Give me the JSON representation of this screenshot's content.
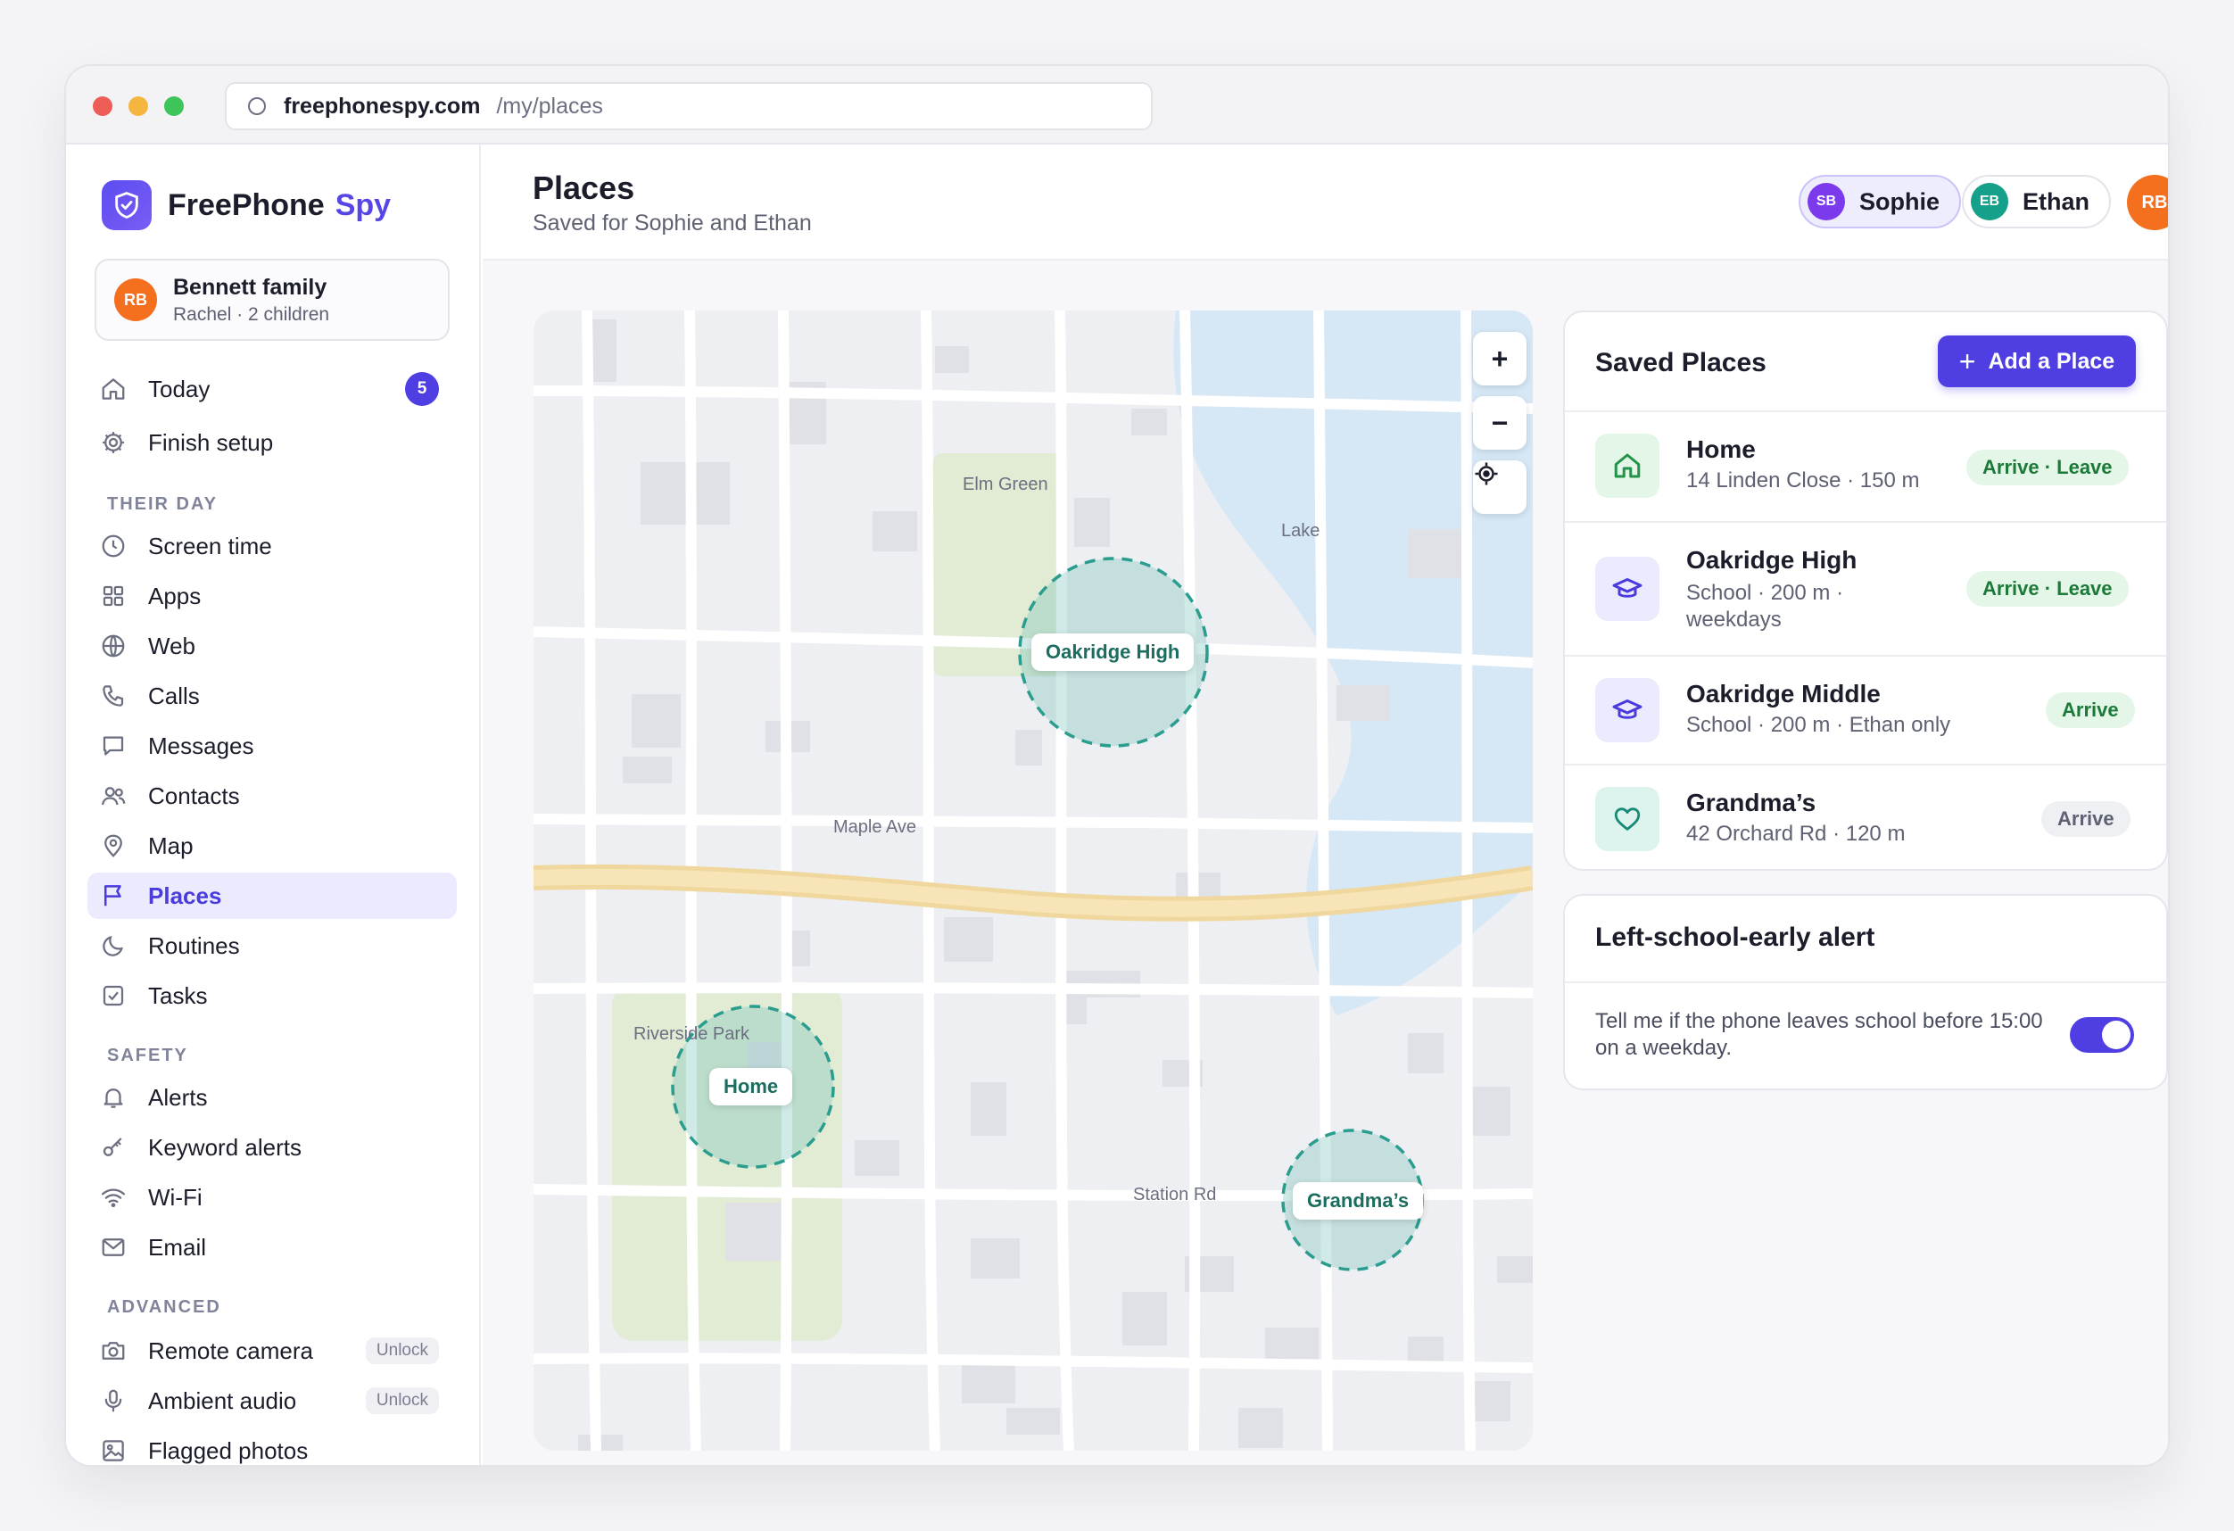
{
  "browser": {
    "domain": "freephonespy.com",
    "path": "/my/places"
  },
  "brand": {
    "name": "FreePhone",
    "accent": "Spy"
  },
  "family": {
    "initials": "RB",
    "name": "Bennett family",
    "sub": "Rachel · 2 children"
  },
  "nav": {
    "today": {
      "label": "Today",
      "badge": "5"
    },
    "finish_setup": "Finish setup",
    "section_day": "THEIR DAY",
    "screen_time": "Screen time",
    "apps": "Apps",
    "web": "Web",
    "calls": "Calls",
    "messages": "Messages",
    "contacts": "Contacts",
    "map": "Map",
    "places": "Places",
    "routines": "Routines",
    "tasks": "Tasks",
    "section_safety": "SAFETY",
    "alerts": "Alerts",
    "keyword_alerts": "Keyword alerts",
    "wifi": "Wi-Fi",
    "email": "Email",
    "section_advanced": "ADVANCED",
    "remote_camera": {
      "label": "Remote camera",
      "badge": "Unlock"
    },
    "ambient_audio": {
      "label": "Ambient audio",
      "badge": "Unlock"
    },
    "flagged_photos": "Flagged photos"
  },
  "header": {
    "title": "Places",
    "subtitle": "Saved for Sophie and Ethan",
    "children": [
      {
        "initials": "SB",
        "name": "Sophie",
        "color": "#7c3aed",
        "active": true
      },
      {
        "initials": "EB",
        "name": "Ethan",
        "color": "#14a08a",
        "active": false
      }
    ],
    "user_initials": "RB"
  },
  "map": {
    "labels": {
      "elm_green": "Elm Green",
      "lake": "Lake",
      "maple_ave": "Maple Ave",
      "riverside_park": "Riverside Park",
      "station_rd": "Station Rd"
    },
    "places": {
      "oakridge_high": "Oakridge High",
      "home": "Home",
      "grandmas": "Grandma’s"
    },
    "controls": {
      "zoom_in": "+",
      "zoom_out": "−"
    }
  },
  "saved_places": {
    "title": "Saved Places",
    "add_label": "Add a Place",
    "items": [
      {
        "name": "Home",
        "sub": "14 Linden Close · 150 m",
        "tag": "Arrive · Leave",
        "icon": "house-icon"
      },
      {
        "name": "Oakridge High",
        "sub": "School · 200 m · weekdays",
        "tag": "Arrive · Leave",
        "icon": "graduation-cap-icon"
      },
      {
        "name": "Oakridge Middle",
        "sub": "School · 200 m · Ethan only",
        "tag": "Arrive",
        "icon": "graduation-cap-icon"
      },
      {
        "name": "Grandma’s",
        "sub": "42 Orchard Rd · 120 m",
        "tag": "Arrive",
        "icon": "heart-icon"
      }
    ]
  },
  "alert_card": {
    "title": "Left-school-early alert",
    "text": "Tell me if the phone leaves school before 15:00 on a weekday.",
    "enabled": true
  },
  "colors": {
    "accent": "#4f3fe3",
    "orange": "#f46f1e",
    "teal": "#1a6d5f",
    "green_tag": "#1c7a39"
  }
}
